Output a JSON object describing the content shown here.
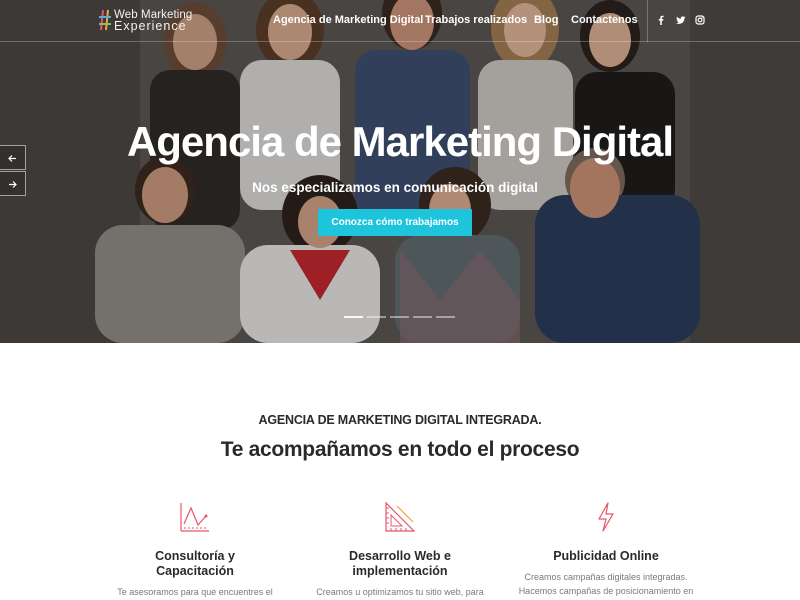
{
  "colors": {
    "accent": "#1ec3dc",
    "icon_pink": "#e8546b",
    "text_dark": "#2a2a2a",
    "text_muted": "#7a7a7a"
  },
  "header": {
    "logo_line1": "Web Marketing",
    "logo_line2": "Experience",
    "nav": [
      {
        "label": "Agencia de Marketing Digital"
      },
      {
        "label": "Trabajos realizados"
      },
      {
        "label": "Blog"
      },
      {
        "label": "Contactenos"
      }
    ],
    "social": [
      "facebook-icon",
      "twitter-icon",
      "instagram-icon"
    ]
  },
  "hero": {
    "title": "Agencia de Marketing Digital",
    "subtitle": "Nos especializamos en comunicación digital",
    "cta": "Conozca cómo trabajamos",
    "slides_count": 5,
    "active_slide": 1
  },
  "section": {
    "kicker": "AGENCIA DE MARKETING DIGITAL INTEGRADA.",
    "title": "Te acompañamos en todo el proceso"
  },
  "services": [
    {
      "icon": "chart-icon",
      "title_line1": "Consultoría y",
      "title_line2": "Capacitación",
      "desc_line1": "Te asesoramos para que encuentres el",
      "desc_line2": ""
    },
    {
      "icon": "ruler-triangle-icon",
      "title_line1": "Desarrollo Web e",
      "title_line2": "implementación",
      "desc_line1": "Creamos u optimizamos tu sitio web, para",
      "desc_line2": ""
    },
    {
      "icon": "lightning-icon",
      "title_line1": "Publicidad Online",
      "title_line2": "",
      "desc_line1": "Creamos campañas digitales integradas.",
      "desc_line2": "Hacemos campañas de posicionamiento en"
    }
  ]
}
